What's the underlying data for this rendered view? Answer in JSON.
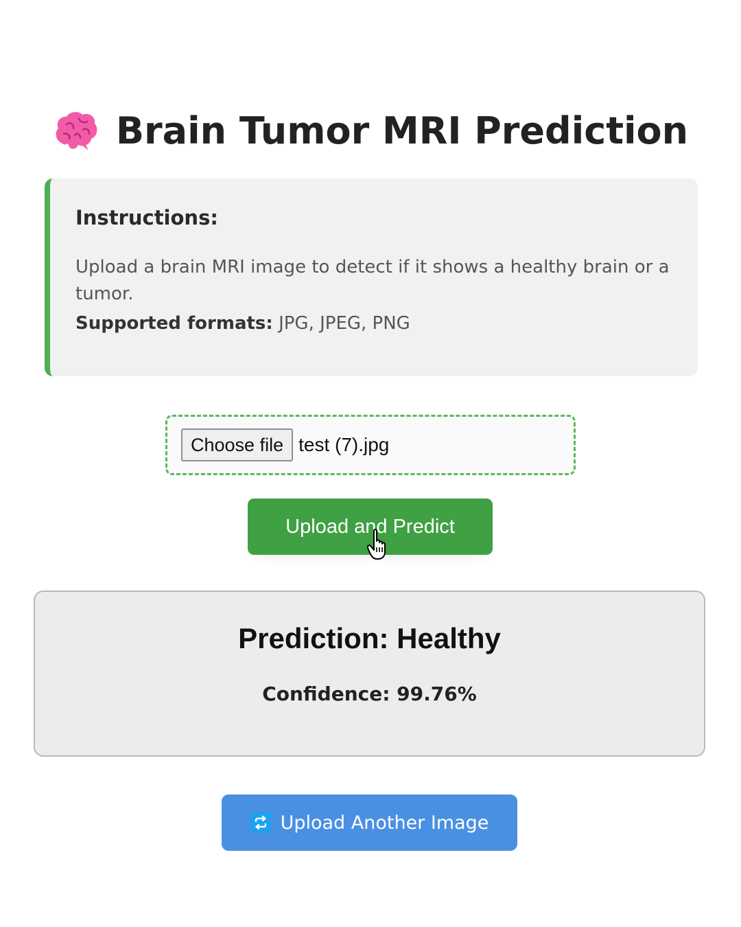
{
  "header": {
    "icon": "brain-icon",
    "title": "Brain Tumor MRI Prediction"
  },
  "instructions": {
    "heading": "Instructions:",
    "text": "Upload a brain MRI image to detect if it shows a healthy brain or a tumor.",
    "formats_label": "Supported formats:",
    "formats_value": " JPG, JPEG, PNG",
    "accent_color": "#4caf50"
  },
  "upload": {
    "choose_label": "Choose file",
    "file_name": "test (7).jpg",
    "predict_label": "Upload and Predict",
    "predict_color": "#3fa143"
  },
  "result": {
    "prediction": "Prediction: Healthy",
    "confidence": "Confidence: 99.76%"
  },
  "actions": {
    "upload_another_icon": "repeat-icon",
    "upload_another_label": "Upload Another Image",
    "upload_another_color": "#4a90e2"
  }
}
